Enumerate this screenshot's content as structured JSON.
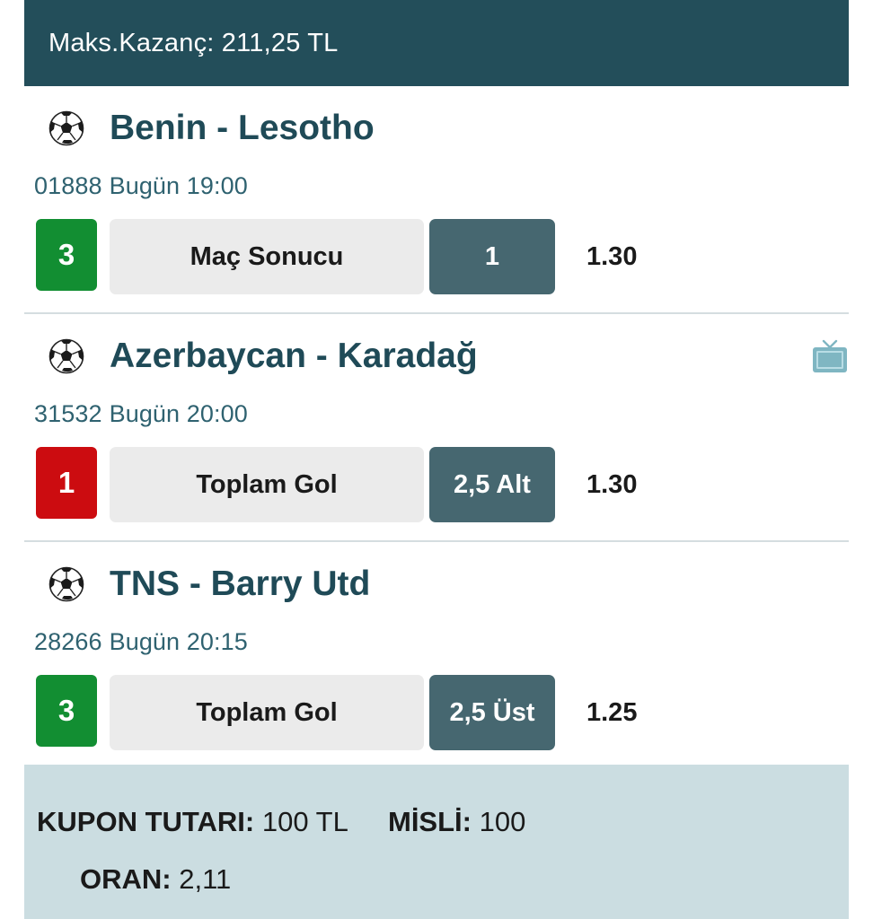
{
  "header": {
    "max_win": "Maks.Kazanç: 211,25 TL"
  },
  "matches": [
    {
      "teams": "Benin - Lesotho",
      "code": "01888",
      "time": "Bugün 19:00",
      "count_badge": "3",
      "badge_color": "#128e32",
      "market": "Maç Sonucu",
      "pick": "1",
      "odds": "1.30",
      "has_tv": false
    },
    {
      "teams": "Azerbaycan - Karadağ",
      "code": "31532",
      "time": "Bugün 20:00",
      "count_badge": "1",
      "badge_color": "#cc0c10",
      "market": "Toplam Gol",
      "pick": "2,5 Alt",
      "odds": "1.30",
      "has_tv": true
    },
    {
      "teams": "TNS - Barry Utd",
      "code": "28266",
      "time": "Bugün 20:15",
      "count_badge": "3",
      "badge_color": "#128e32",
      "market": "Toplam Gol",
      "pick": "2,5 Üst",
      "odds": "1.25",
      "has_tv": false
    }
  ],
  "footer": {
    "coupon_label": "KUPON TUTARI:",
    "coupon_value": "100 TL",
    "misli_label": "MİSLİ:",
    "misli_value": "100",
    "oran_label": "ORAN:",
    "oran_value": "2,11"
  },
  "icons": {
    "sport": "soccer-ball-icon",
    "tv": "tv-icon"
  },
  "colors": {
    "header_bg": "#234e5a",
    "team_text": "#1f4a57",
    "pick_bg": "#466770",
    "footer_bg": "#cbdde1",
    "tv_icon": "#7fb6c2"
  }
}
